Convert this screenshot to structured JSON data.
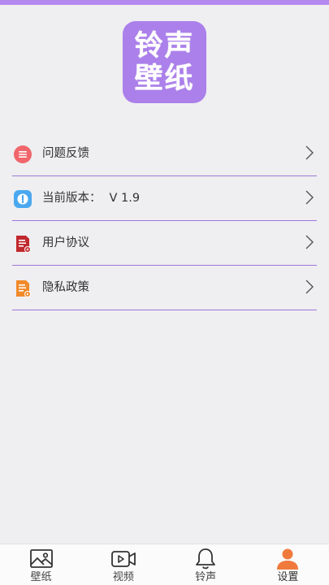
{
  "logo": {
    "line1": "铃声",
    "line2": "壁纸"
  },
  "menu": {
    "items": [
      {
        "label": "问题反馈",
        "value": "",
        "icon": "feedback-icon"
      },
      {
        "label": "当前版本：",
        "value": "V 1.9",
        "icon": "version-icon"
      },
      {
        "label": "用户协议",
        "value": "",
        "icon": "agreement-icon"
      },
      {
        "label": "隐私政策",
        "value": "",
        "icon": "privacy-icon"
      }
    ]
  },
  "tabbar": {
    "tabs": [
      {
        "label": "壁纸",
        "icon": "image-icon"
      },
      {
        "label": "视频",
        "icon": "video-icon"
      },
      {
        "label": "铃声",
        "icon": "bell-icon"
      },
      {
        "label": "设置",
        "icon": "person-icon",
        "active": true
      }
    ]
  },
  "colors": {
    "accent": "#ab80ea",
    "divider": "#9d78d8",
    "active_tab": "#f07a3c"
  }
}
